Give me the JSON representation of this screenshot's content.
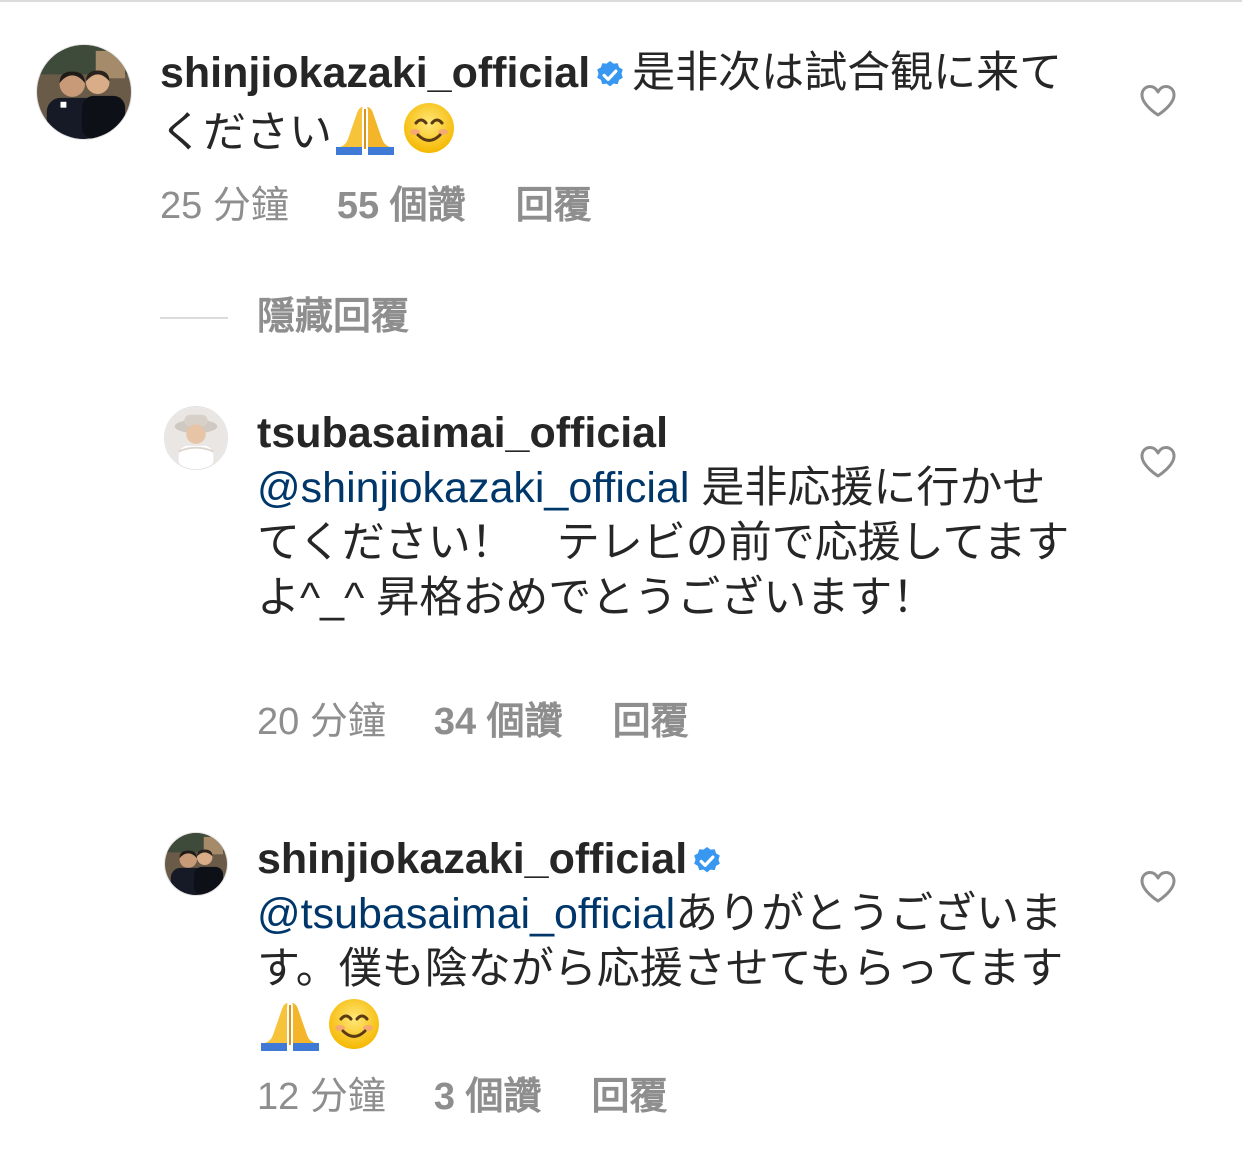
{
  "comments": [
    {
      "username": "shinjiokazaki_official",
      "verified": true,
      "mention": "",
      "text_a": "是非次は試合観に来てください",
      "text_b": "",
      "emojis": [
        "folded-hands-emoji",
        "smiling-face-emoji"
      ],
      "time": "25 分鐘",
      "likes": "55 個讚",
      "reply": "回覆"
    },
    {
      "username": "tsubasaimai_official",
      "verified": false,
      "mention": "@shinjiokazaki_official",
      "text_a": " 是非応援に行かせてください！　テレビの前で応援してますよ^_^ 昇格おめでとうございます！",
      "time": "20 分鐘",
      "likes": "34 個讚",
      "reply": "回覆"
    },
    {
      "username": "shinjiokazaki_official",
      "verified": true,
      "mention": "@tsubasaimai_official",
      "text_a": "ありがとうございます。僕も陰ながら応援させてもらってます",
      "emojis": [
        "folded-hands-emoji",
        "smiling-face-emoji"
      ],
      "time": "12 分鐘",
      "likes": "3 個讚",
      "reply": "回覆"
    }
  ],
  "thread": {
    "hide_replies_label": "隱藏回覆"
  },
  "colors": {
    "text": "#262626",
    "meta": "#8e8e8e",
    "mention": "#00376b",
    "verified": "#3897f0",
    "divider": "#dbdbdb"
  },
  "icons": {
    "like": "heart-outline-icon",
    "verified": "verified-badge-icon"
  }
}
